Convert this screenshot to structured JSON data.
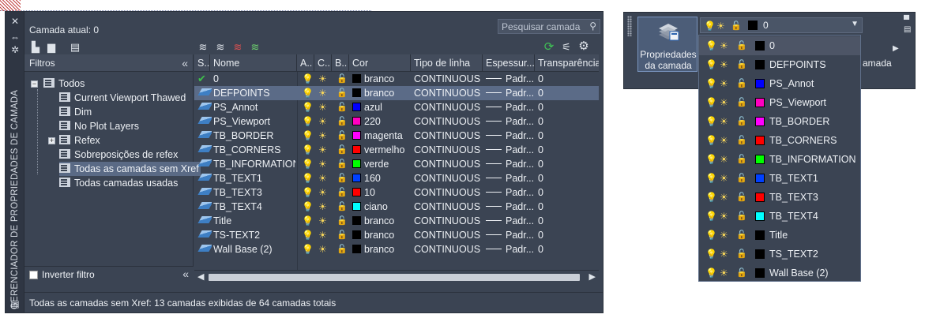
{
  "manager": {
    "vertical_title": "GERENCIADOR DE PROPRIEDADES DE CAMADA",
    "current_layer": "Camada atual: 0",
    "search_placeholder": "Pesquisar camada",
    "filters_header": "Filtros",
    "invert_filter": "Inverter filtro",
    "status": "Todas as camadas sem Xref: 13 camadas exibidas de 64 camadas totais",
    "tree": [
      {
        "label": "Todos",
        "level": 0
      },
      {
        "label": "Current Viewport Thawed",
        "level": 1
      },
      {
        "label": "Dim",
        "level": 1
      },
      {
        "label": "No Plot Layers",
        "level": 1
      },
      {
        "label": "Refex",
        "level": 1
      },
      {
        "label": "Sobreposições de refex",
        "level": 1
      },
      {
        "label": "Todas as camadas sem Xref",
        "level": 1,
        "selected": true
      },
      {
        "label": "Todas camadas usadas",
        "level": 1
      }
    ],
    "columns": [
      "S..",
      "Nome",
      "A..",
      "C..",
      "B..",
      "Cor",
      "Tipo de linha",
      "Espessur...",
      "Transparência"
    ],
    "rows": [
      {
        "name": "0",
        "color_name": "branco",
        "color": "#000000",
        "linetype": "CONTINUOUS",
        "lineweight": "Padr...",
        "transparency": "0",
        "current": true
      },
      {
        "name": "DEFPOINTS",
        "color_name": "branco",
        "color": "#000000",
        "linetype": "CONTINUOUS",
        "lineweight": "Padr...",
        "transparency": "0",
        "selected": true
      },
      {
        "name": "PS_Annot",
        "color_name": "azul",
        "color": "#0000ff",
        "linetype": "CONTINUOUS",
        "lineweight": "Padr...",
        "transparency": "0"
      },
      {
        "name": "PS_Viewport",
        "color_name": "220",
        "color": "#ff00c0",
        "linetype": "CONTINUOUS",
        "lineweight": "Padr...",
        "transparency": "0"
      },
      {
        "name": "TB_BORDER",
        "color_name": "magenta",
        "color": "#ff00ff",
        "linetype": "CONTINUOUS",
        "lineweight": "Padr...",
        "transparency": "0"
      },
      {
        "name": "TB_CORNERS",
        "color_name": "vermelho",
        "color": "#ff0000",
        "linetype": "CONTINUOUS",
        "lineweight": "Padr...",
        "transparency": "0"
      },
      {
        "name": "TB_INFORMATION",
        "color_name": "verde",
        "color": "#00ff00",
        "linetype": "CONTINUOUS",
        "lineweight": "Padr...",
        "transparency": "0"
      },
      {
        "name": "TB_TEXT1",
        "color_name": "160",
        "color": "#0040ff",
        "linetype": "CONTINUOUS",
        "lineweight": "Padr...",
        "transparency": "0"
      },
      {
        "name": "TB_TEXT3",
        "color_name": "10",
        "color": "#ff0000",
        "linetype": "CONTINUOUS",
        "lineweight": "Padr...",
        "transparency": "0"
      },
      {
        "name": "TB_TEXT4",
        "color_name": "ciano",
        "color": "#00ffff",
        "linetype": "CONTINUOUS",
        "lineweight": "Padr...",
        "transparency": "0"
      },
      {
        "name": "Title",
        "color_name": "branco",
        "color": "#000000",
        "linetype": "CONTINUOUS",
        "lineweight": "Padr...",
        "transparency": "0"
      },
      {
        "name": "TS-TEXT2",
        "color_name": "branco",
        "color": "#000000",
        "linetype": "CONTINUOUS",
        "lineweight": "Padr...",
        "transparency": "0"
      },
      {
        "name": "Wall Base (2)",
        "color_name": "branco",
        "color": "#000000",
        "linetype": "CONTINUOUS",
        "lineweight": "Padr...",
        "transparency": "0"
      }
    ]
  },
  "ribbon": {
    "button_label": "Propriedades da camada",
    "combo_value": "0",
    "combo_color": "#000000",
    "panel_label": "amada",
    "dropdown": [
      {
        "name": "0",
        "color": "#000000",
        "selected": true
      },
      {
        "name": "DEFPOINTS",
        "color": "#000000"
      },
      {
        "name": "PS_Annot",
        "color": "#0000ff"
      },
      {
        "name": "PS_Viewport",
        "color": "#ff00c0"
      },
      {
        "name": "TB_BORDER",
        "color": "#ff00ff"
      },
      {
        "name": "TB_CORNERS",
        "color": "#ff0000"
      },
      {
        "name": "TB_INFORMATION",
        "color": "#00ff00"
      },
      {
        "name": "TB_TEXT1",
        "color": "#0040ff"
      },
      {
        "name": "TB_TEXT3",
        "color": "#ff0000"
      },
      {
        "name": "TB_TEXT4",
        "color": "#00ffff"
      },
      {
        "name": "Title",
        "color": "#000000"
      },
      {
        "name": "TS_TEXT2",
        "color": "#000000"
      },
      {
        "name": "Wall Base (2)",
        "color": "#000000"
      }
    ]
  }
}
